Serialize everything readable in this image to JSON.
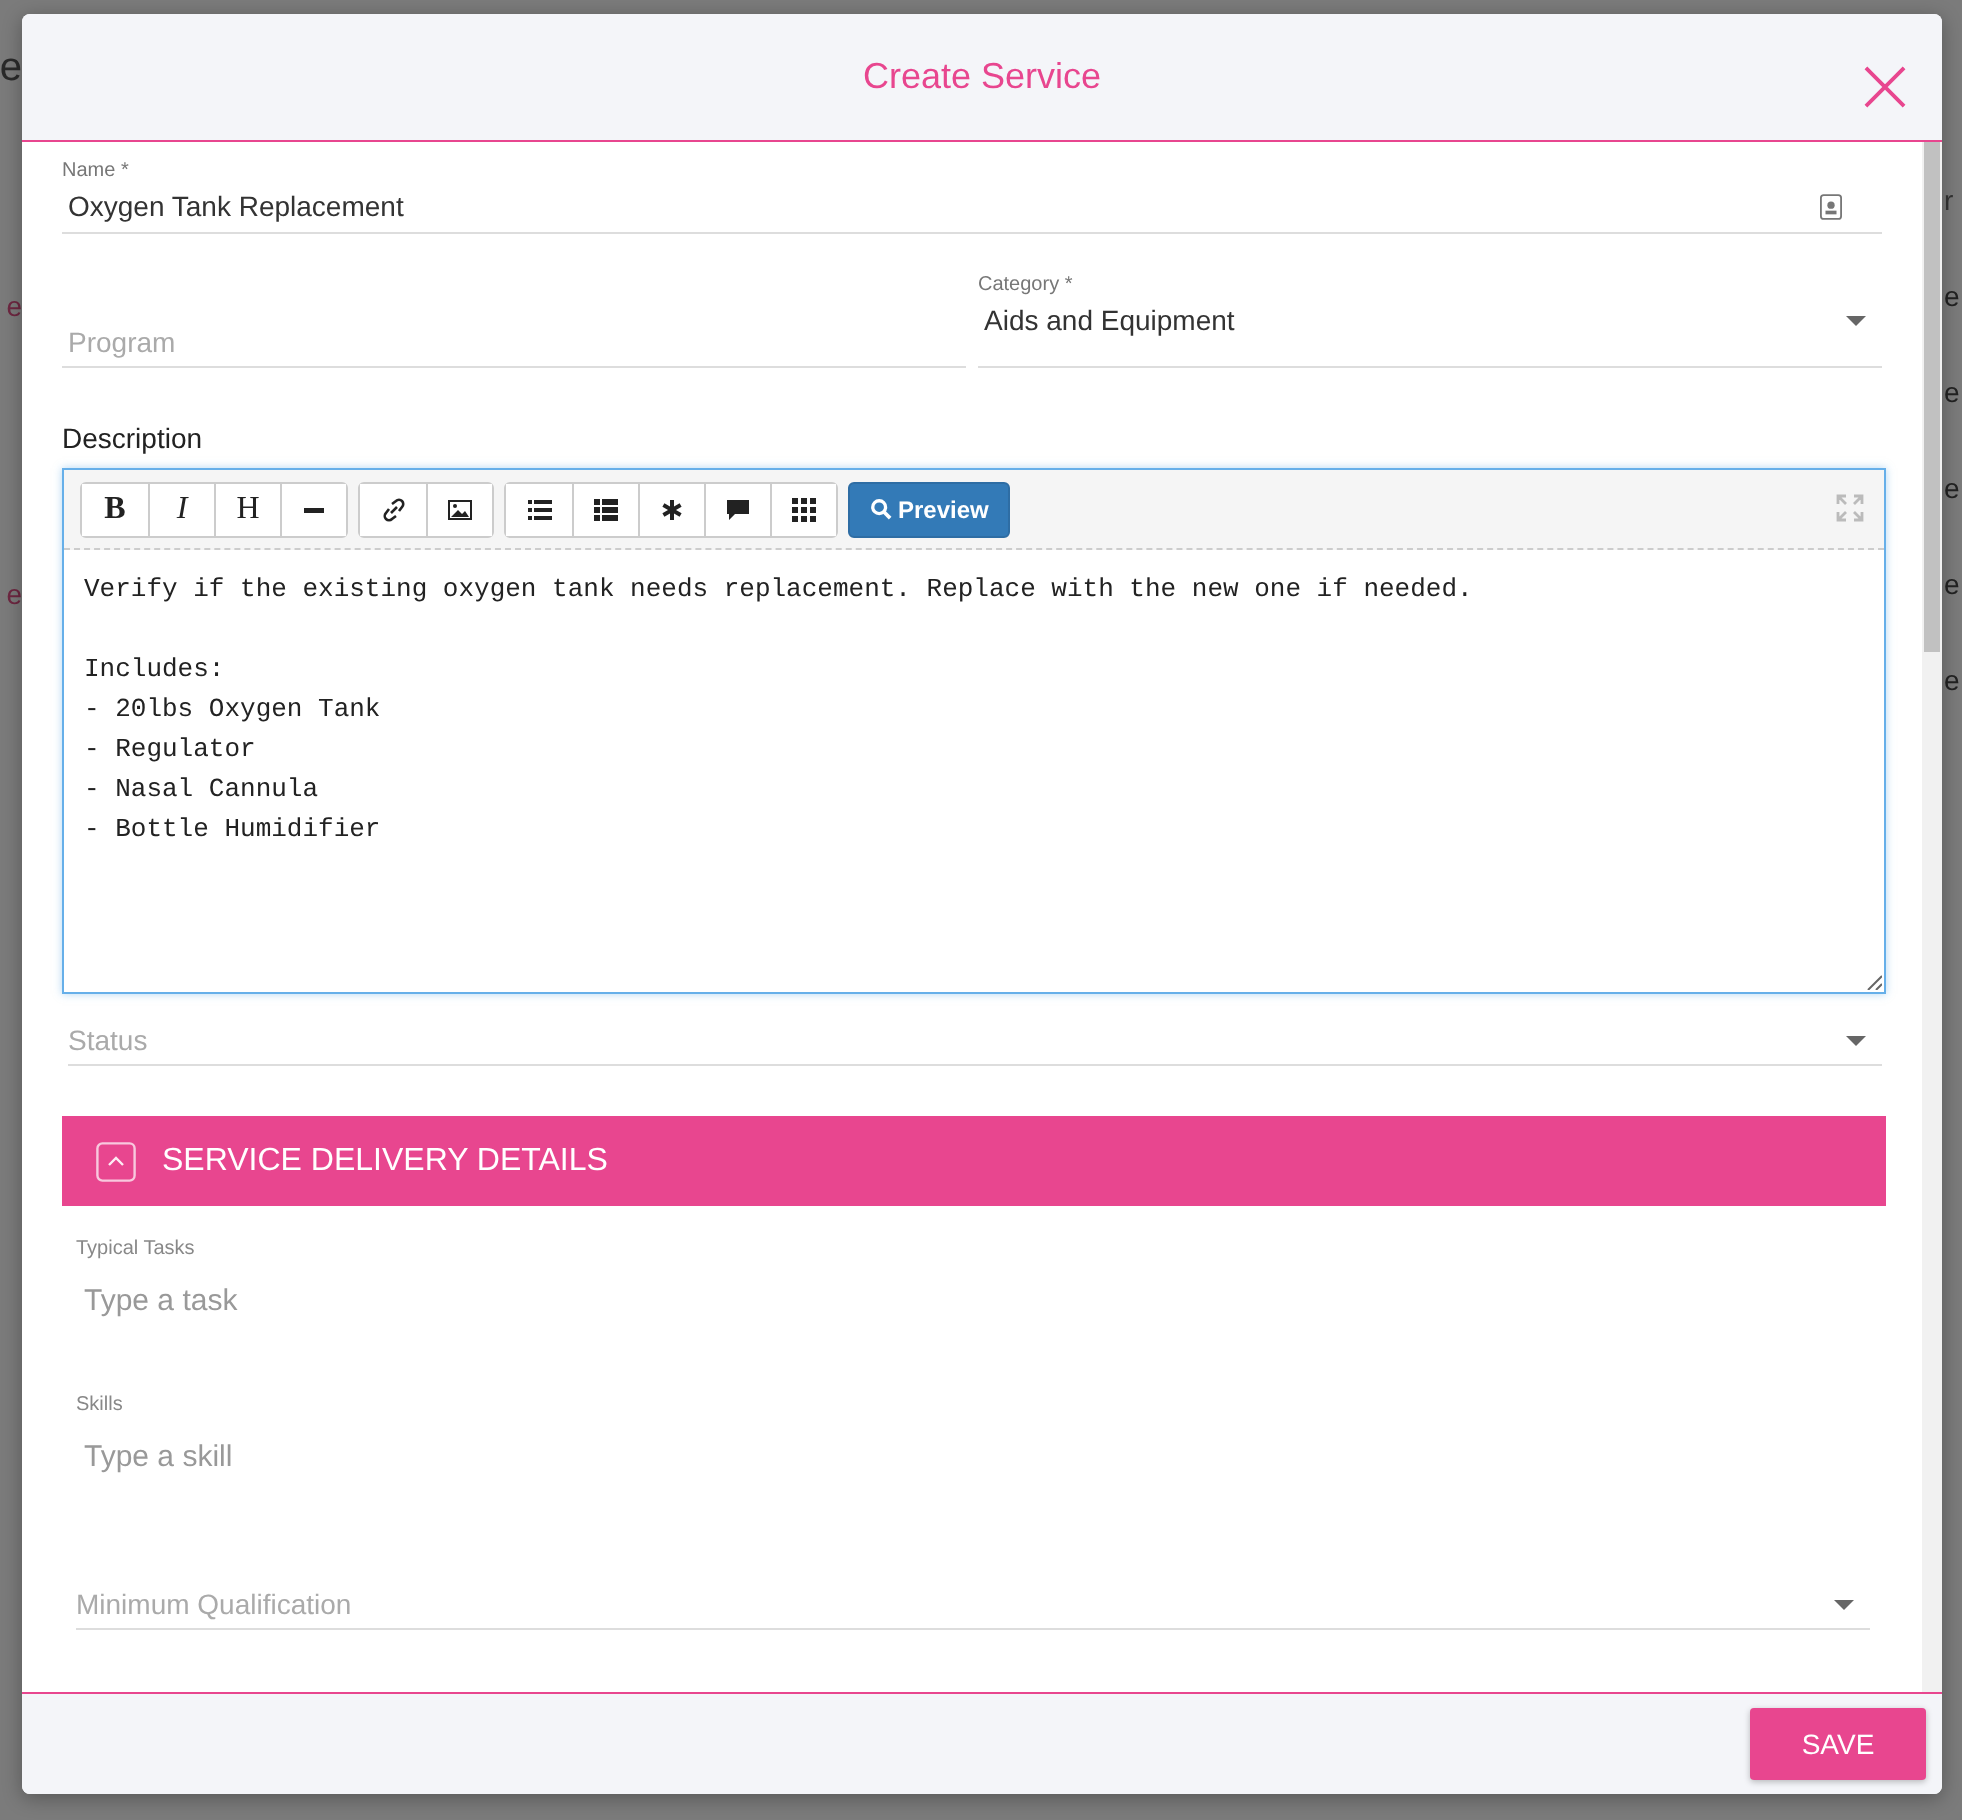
{
  "background": {
    "left_fragments": [
      {
        "text": "e",
        "kind": "title"
      },
      {
        "text": "e",
        "kind": "link"
      },
      {
        "text": "e",
        "kind": "link"
      }
    ],
    "right_fragments": [
      {
        "text": "r",
        "kind": "header"
      },
      {
        "text": "e",
        "kind": "cell"
      },
      {
        "text": "e",
        "kind": "cell"
      },
      {
        "text": "e",
        "kind": "cell"
      },
      {
        "text": "e",
        "kind": "cell"
      },
      {
        "text": "e",
        "kind": "cell"
      }
    ]
  },
  "dialog": {
    "title": "Create Service",
    "name": {
      "label": "Name *",
      "value": "Oxygen Tank Replacement"
    },
    "program": {
      "placeholder": "Program"
    },
    "category": {
      "label": "Category *",
      "value": "Aids and Equipment"
    },
    "description": {
      "label": "Description",
      "toolbar": [
        [
          {
            "kind": "bold",
            "label": "B"
          },
          {
            "kind": "italic",
            "label": "I"
          },
          {
            "kind": "heading",
            "label": "H"
          },
          {
            "kind": "rule"
          }
        ],
        [
          {
            "kind": "link"
          },
          {
            "kind": "image"
          }
        ],
        [
          {
            "kind": "bullets"
          },
          {
            "kind": "numbered"
          },
          {
            "kind": "asterisk"
          },
          {
            "kind": "comment"
          },
          {
            "kind": "grid"
          }
        ]
      ],
      "preview_button": "Preview",
      "value": "Verify if the existing oxygen tank needs replacement. Replace with the new one if needed.\n\nIncludes:\n- 20lbs Oxygen Tank\n- Regulator\n- Nasal Cannula\n- Bottle Humidifier"
    },
    "status": {
      "placeholder": "Status"
    },
    "section": {
      "title": "SERVICE DELIVERY DETAILS",
      "expanded": true
    },
    "typical_tasks": {
      "label": "Typical Tasks",
      "placeholder": "Type a task"
    },
    "skills": {
      "label": "Skills",
      "placeholder": "Type a skill"
    },
    "minimum_qualification": {
      "placeholder": "Minimum Qualification"
    },
    "save_button": "SAVE"
  }
}
